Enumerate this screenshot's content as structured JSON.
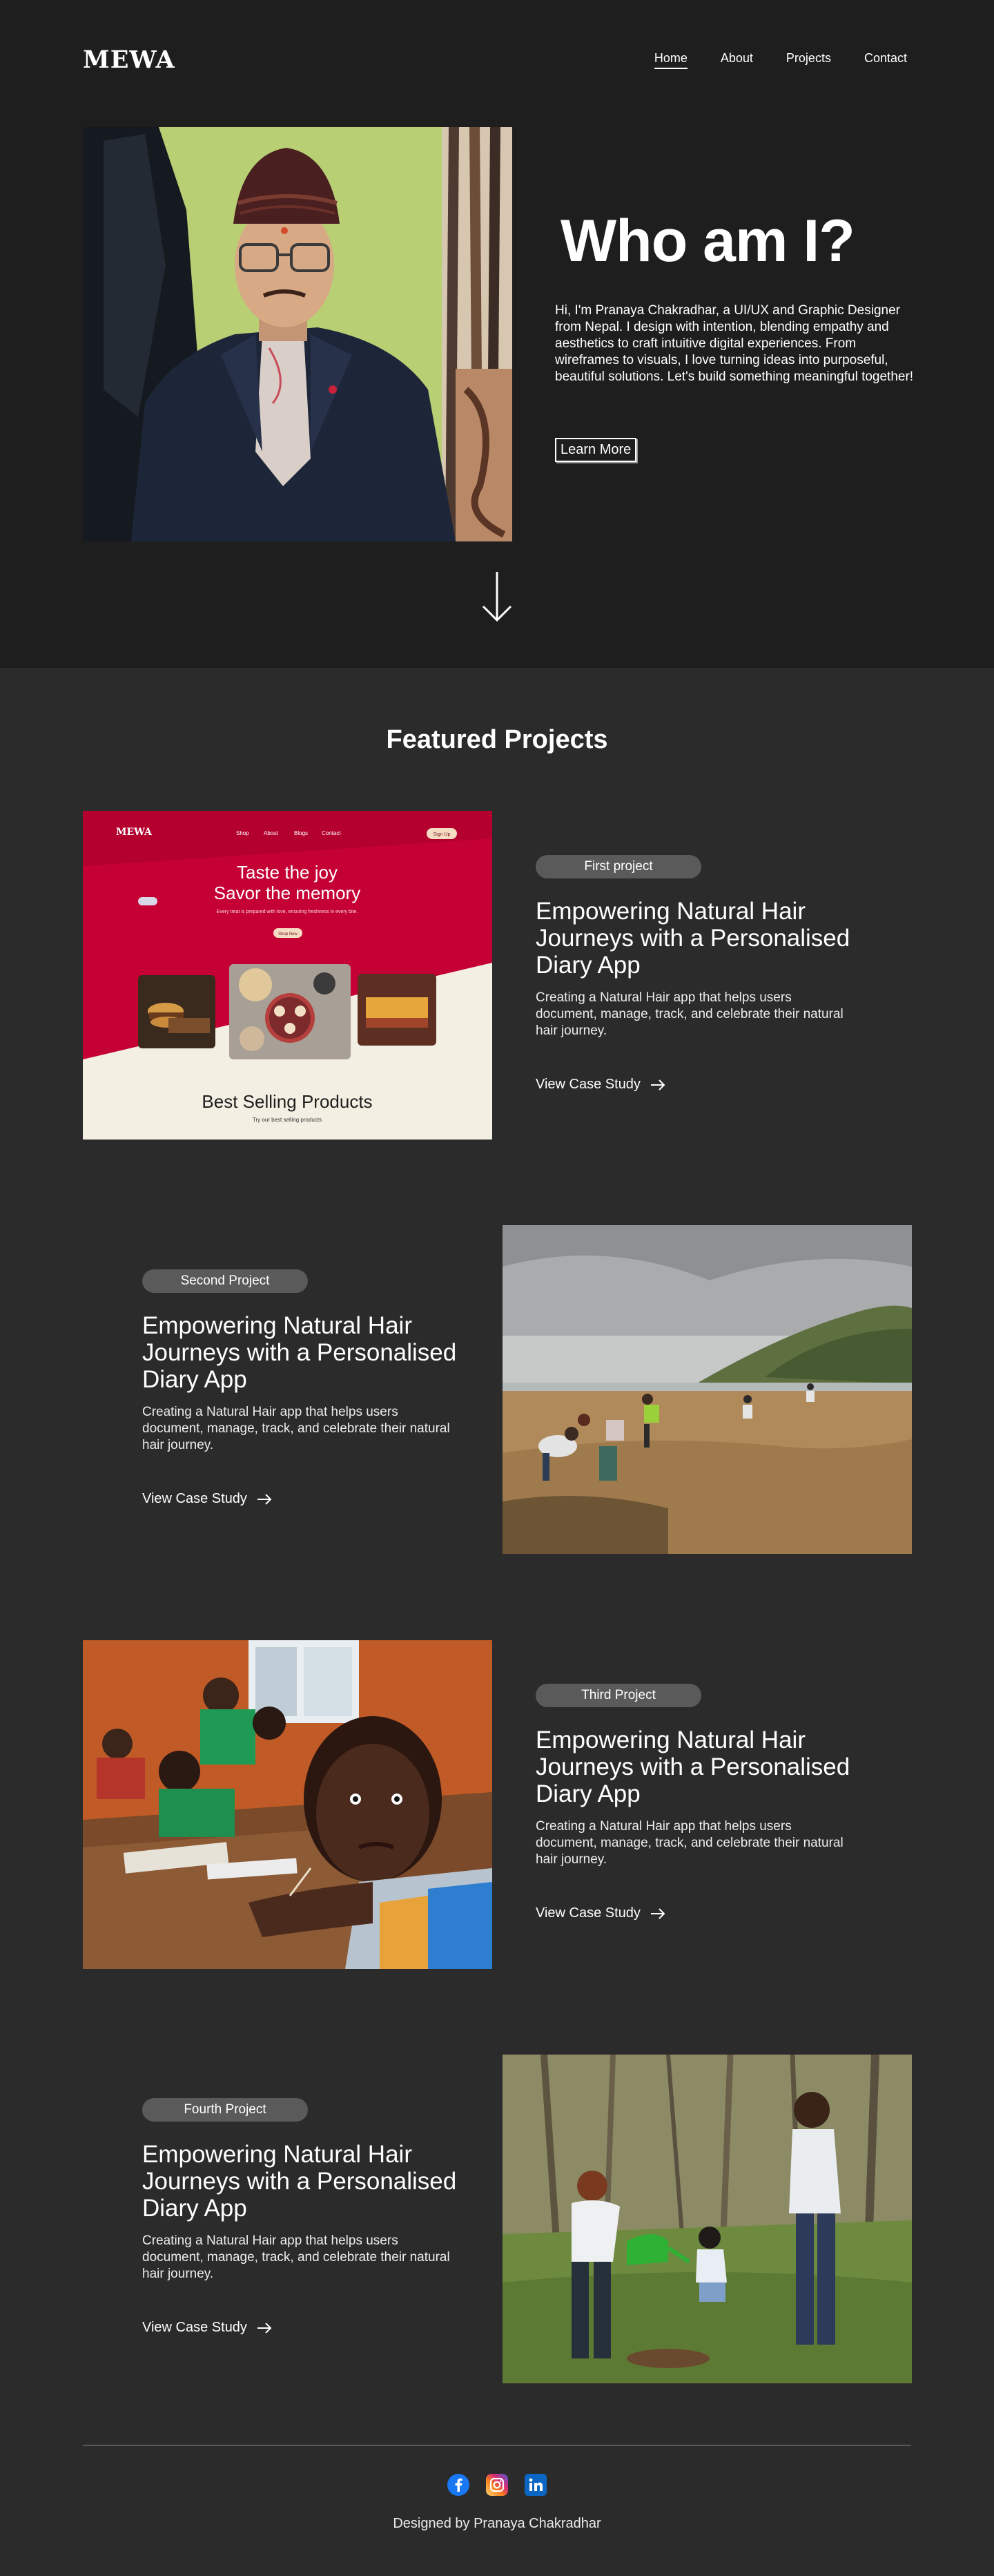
{
  "header": {
    "logo": "MEWA",
    "nav": [
      "Home",
      "About",
      "Projects",
      "Contact"
    ]
  },
  "hero": {
    "title": "Who am I?",
    "bio": "Hi, I'm Pranaya Chakradhar, a UI/UX and Graphic Designer from Nepal.   I design with intention, blending empathy and aesthetics to craft intuitive digital experiences. From wireframes to visuals, I love turning ideas into purposeful, beautiful solutions. Let's build something meaningful together!",
    "button": "Learn More",
    "scroll_icon": "arrow-down-icon"
  },
  "featured": {
    "title": "Featured Projects",
    "projects": [
      {
        "badge": "First project",
        "title": "Empowering Natural Hair Journeys with a Personalised Diary App",
        "description": "Creating a Natural Hair app that helps users document, manage, track, and celebrate their natural hair journey.",
        "link": "View Case Study"
      },
      {
        "badge": "Second Project",
        "title": "Empowering Natural Hair Journeys with a Personalised Diary App",
        "description": "Creating a Natural Hair app that helps users document, manage, track, and celebrate their natural hair journey.",
        "link": "View Case Study"
      },
      {
        "badge": "Third Project",
        "title": "Empowering Natural Hair Journeys with a Personalised Diary App",
        "description": "Creating a Natural Hair app that helps users document, manage, track, and celebrate their natural hair journey.",
        "link": "View Case Study"
      },
      {
        "badge": "Fourth Project",
        "title": "Empowering Natural Hair Journeys with a Personalised Diary App",
        "description": "Creating a Natural Hair app that helps users document, manage, track, and celebrate their natural hair journey.",
        "link": "View Case Study"
      }
    ],
    "mockup": {
      "logo": "MEWA",
      "nav": [
        "Shop",
        "About",
        "Blogs",
        "Contact"
      ],
      "signup": "Sign Up",
      "headline1": "Taste the joy",
      "headline2": "Savor the memory",
      "tagline": "Every treat is prepared with love, ensuring freshness in every bite.",
      "shop": "Shop Now",
      "section": "Best Selling Products",
      "section_sub": "Try our best selling products"
    }
  },
  "footer": {
    "socials": [
      "facebook-icon",
      "instagram-icon",
      "linkedin-icon"
    ],
    "credit": "Designed by Pranaya Chakradhar"
  },
  "colors": {
    "hero_bg": "#1e1e1e",
    "page_bg": "#2b2b2b",
    "badge_bg": "#5a5a5a",
    "mockup_red": "#c40034"
  }
}
